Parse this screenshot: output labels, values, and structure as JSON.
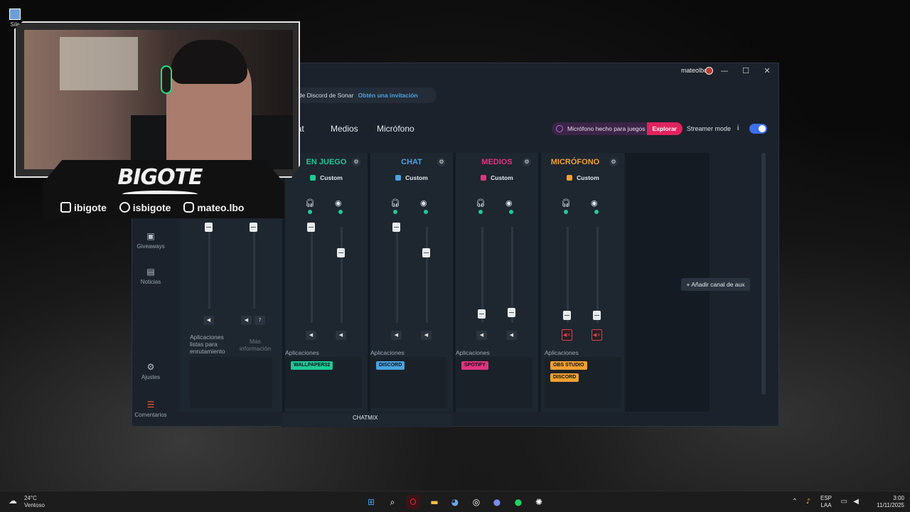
{
  "desktop": {
    "icon_label": "Sile"
  },
  "window": {
    "user": "mateolbo",
    "controls": {
      "minimize": "—",
      "maximize": "☐",
      "close": "✕"
    },
    "banner": {
      "text": "lor de Discord de Sonar",
      "link": "Obtén una invitación"
    },
    "tabs": [
      "hat",
      "Medios",
      "Micrófono"
    ],
    "mic_pill": {
      "text": "Micrófono hecho para juegos",
      "action": "Explorar"
    },
    "streamer_mode": "Streamer mode",
    "info": "i"
  },
  "sidebar": [
    {
      "label": "Giveaways",
      "icon": "gift-icon"
    },
    {
      "label": "Noticias",
      "icon": "news-icon"
    },
    {
      "label": "Ajustes",
      "icon": "gear-icon"
    },
    {
      "label": "Comentarios",
      "icon": "comments-icon"
    }
  ],
  "routing_column": {
    "text1": "Aplicaciones listas para enrutamiento",
    "text2": "Más información"
  },
  "channels": [
    {
      "name": "EN JUEGO",
      "color": "#20c997",
      "preset": "Custom",
      "apps_label": "Aplicaciones",
      "apps": [
        {
          "name": "WALLPAPER32",
          "color": "#20c997"
        }
      ]
    },
    {
      "name": "CHAT",
      "color": "#4aa3e0",
      "preset": "Custom",
      "apps_label": "Aplicaciones",
      "apps": [
        {
          "name": "DISCORD",
          "color": "#4aa3e0"
        }
      ]
    },
    {
      "name": "MEDIOS",
      "color": "#e0347f",
      "preset": "Custom",
      "apps_label": "Aplicaciones",
      "apps": [
        {
          "name": "SPOTIFY",
          "color": "#e0347f"
        }
      ]
    },
    {
      "name": "MICRÓFONO",
      "color": "#f0a030",
      "preset": "Custom",
      "apps_label": "Aplicaciones",
      "apps": [
        {
          "name": "OBS STUDIO",
          "color": "#f0a030"
        },
        {
          "name": "DISCORD",
          "color": "#f0a030"
        }
      ]
    }
  ],
  "add_aux": "+ Añadir canal de aux",
  "chatmix": "CHATMIX",
  "overlay": {
    "brand": "BIGOTE",
    "socials": [
      "ibigote",
      "isbigote",
      "mateo.lbo"
    ]
  },
  "taskbar": {
    "temperature": "24°C",
    "condition": "Ventoso",
    "lang1": "ESP",
    "lang2": "LAA",
    "time": "3:00",
    "date": "11/11/2025"
  }
}
